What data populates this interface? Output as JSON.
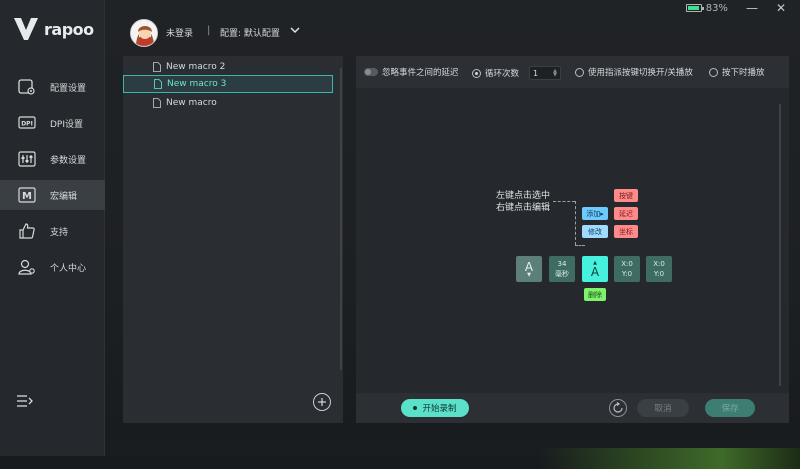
{
  "window": {
    "battery_percent": "83%",
    "battery_level": 0.83,
    "min_label": "—",
    "close_label": "✕"
  },
  "brand": {
    "logo_text": "rapoo"
  },
  "sidebar": {
    "items": [
      {
        "label": "配置设置",
        "icon": "mouse-settings-icon",
        "active": false
      },
      {
        "label": "DPI设置",
        "icon": "dpi-icon",
        "active": false
      },
      {
        "label": "参数设置",
        "icon": "sliders-icon",
        "active": false
      },
      {
        "label": "宏编辑",
        "icon": "macro-icon",
        "active": true
      },
      {
        "label": "支持",
        "icon": "thumbs-up-icon",
        "active": false
      },
      {
        "label": "个人中心",
        "icon": "user-gear-icon",
        "active": false
      }
    ]
  },
  "header": {
    "user": "未登录",
    "separator": "|",
    "config": "配置: 默认配置"
  },
  "macros": {
    "items": [
      {
        "label": "New macro 2",
        "selected": false
      },
      {
        "label": "New macro 3",
        "selected": true
      },
      {
        "label": "New macro",
        "selected": false
      }
    ]
  },
  "toolbar": {
    "ignore_delay": "忽略事件之间的延迟",
    "loop_count_label": "循环次数",
    "loop_count_value": "1",
    "toggle_by_key": "使用指派按键切换开/关播放",
    "play_while_pressed": "按下时播放"
  },
  "hint": {
    "line1": "左键点击选中",
    "line2": "右键点击编辑"
  },
  "chips": {
    "key": "按键",
    "delay": "延迟",
    "coord": "坐标",
    "add": "添加▸",
    "modify": "修改",
    "delete": "删除"
  },
  "sequence": {
    "key_down": {
      "letter": "A",
      "arrow": "▼"
    },
    "delay": {
      "value": "34",
      "unit": "毫秒"
    },
    "key_up": {
      "letter": "A",
      "arrow": "▲"
    },
    "pos1": {
      "x": "X:0",
      "y": "Y:0"
    },
    "pos2": {
      "x": "X:0",
      "y": "Y:0"
    }
  },
  "bottom": {
    "record": "开始录制",
    "cancel": "取消",
    "save": "保存"
  }
}
